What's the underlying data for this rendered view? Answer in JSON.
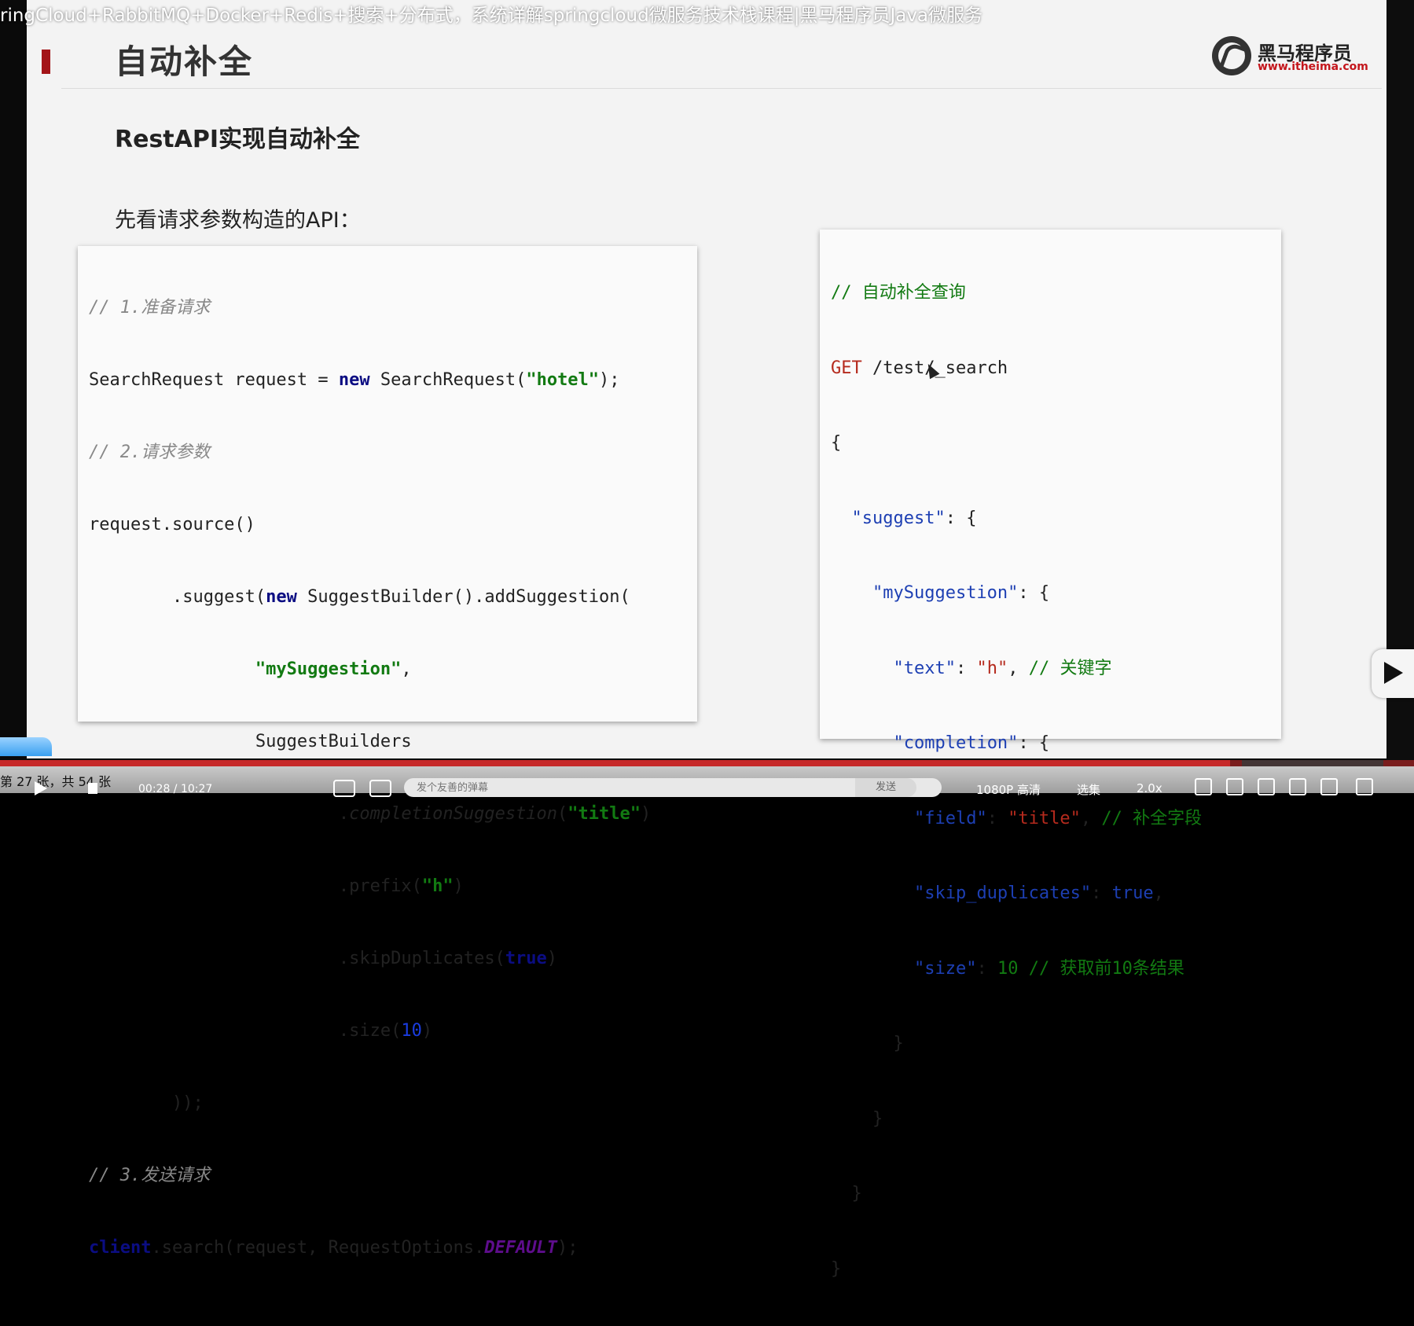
{
  "video": {
    "title": "ringCloud+RabbitMQ+Docker+Redis+搜索+分布式，系统详解springcloud微服务技术栈课程|黑马程序员Java微服务"
  },
  "slide": {
    "title": "自动补全",
    "section_heading": "RestAPI实现自动补全",
    "intro": "先看请求参数构造的API：",
    "logo": {
      "name": "黑马程序员",
      "url": "www.itheima.com"
    },
    "java_code": {
      "c1": "// 1.准备请求",
      "l2a": "SearchRequest request = ",
      "l2kw": "new",
      "l2b": " SearchRequest(",
      "l2str": "\"hotel\"",
      "l2c": ");",
      "c3": "// 2.请求参数",
      "l4": "request.source()",
      "l5a": "        .suggest(",
      "l5kw": "new",
      "l5b": " SuggestBuilder().addSuggestion(",
      "l6a": "                ",
      "l6str": "\"mySuggestion\"",
      "l6b": ",",
      "l7": "                SuggestBuilders",
      "l8a": "                        .",
      "l8ital": "completionSuggestion",
      "l8b": "(",
      "l8str": "\"title\"",
      "l8c": ")",
      "l9a": "                        .prefix(",
      "l9str": "\"h\"",
      "l9b": ")",
      "l10a": "                        .skipDuplicates(",
      "l10kw": "true",
      "l10b": ")",
      "l11a": "                        .size(",
      "l11num": "10",
      "l11b": ")",
      "l12": "        ));",
      "c13": "// 3.发送请求",
      "l14kw": "client",
      "l14a": ".search(request, RequestOptions.",
      "l14const": "DEFAULT",
      "l14b": ");"
    },
    "rest_code": {
      "c1": "// 自动补全查询",
      "method": "GET",
      "path": " /test/_search",
      "l3": "{",
      "l4a": "  ",
      "l4key": "\"suggest\"",
      "l4b": ": {",
      "l5a": "    ",
      "l5key": "\"mySuggestion\"",
      "l5b": ": {",
      "l6a": "      ",
      "l6key": "\"text\"",
      "l6b": ": ",
      "l6str": "\"h\"",
      "l6c": ", ",
      "l6cmt": "// 关键字",
      "l7a": "      ",
      "l7key": "\"completion\"",
      "l7b": ": {",
      "l8a": "        ",
      "l8key": "\"field\"",
      "l8b": ": ",
      "l8str": "\"title\"",
      "l8c": ", ",
      "l8cmt": "// 补全字段",
      "l9a": "        ",
      "l9key": "\"skip_duplicates\"",
      "l9b": ": ",
      "l9bool": "true",
      "l9c": ",",
      "l10a": "        ",
      "l10key": "\"size\"",
      "l10b": ": ",
      "l10num": "10",
      "l10c": " ",
      "l10cmt": "// 获取前10条结果",
      "l11": "      }",
      "l12": "    }",
      "l13": "  }",
      "l14": "}"
    }
  },
  "player": {
    "slide_counter": "第 27 张，共 54 张",
    "time": "00:28 / 10:27",
    "progress_fraction": 0.87,
    "danmaku_placeholder": "发个友善的弹幕",
    "send_label": "发送",
    "quality_label": "1080P 高清",
    "select_label": "选集",
    "speed_label": "2.0x"
  }
}
